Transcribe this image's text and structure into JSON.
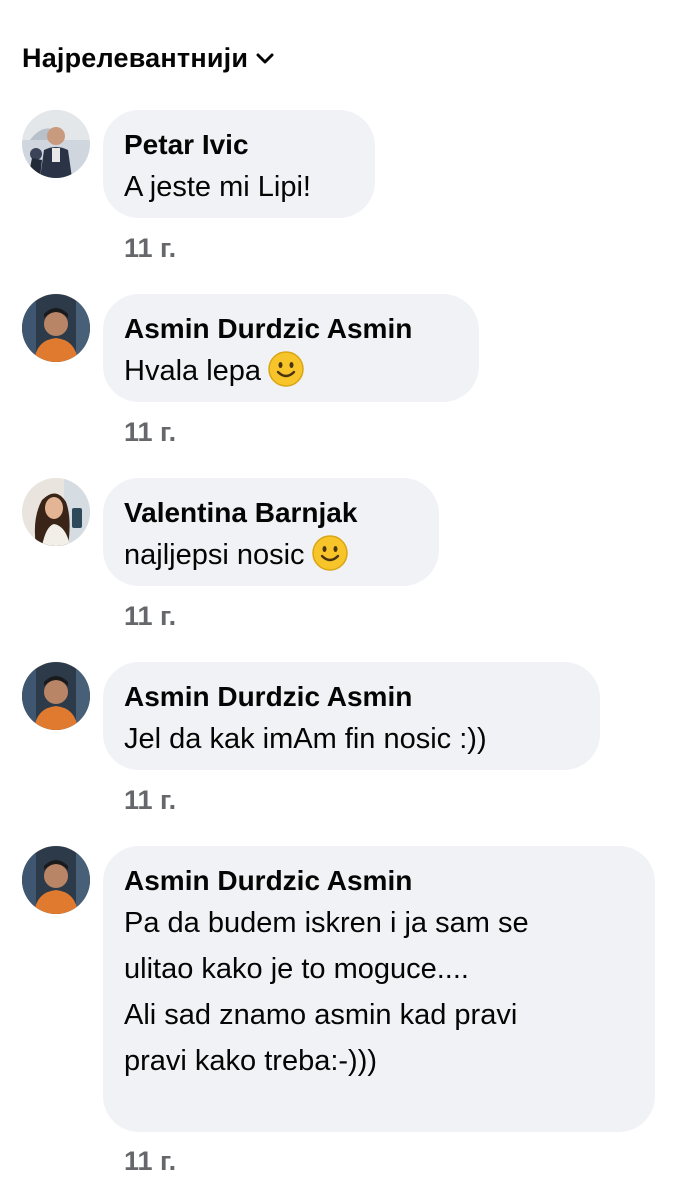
{
  "sort": {
    "label": "Најрелевантнији",
    "icon": "chevron-down-icon"
  },
  "comments": [
    {
      "author": "Petar Ivic",
      "text": "A jeste mi Lipi!",
      "emoji": null,
      "time": "11 г.",
      "avatar_icon": "avatar-petar"
    },
    {
      "author": "Asmin Durdzic Asmin",
      "text": "Hvala lepa",
      "emoji": "smiley-emoji",
      "time": "11 г.",
      "avatar_icon": "avatar-asmin"
    },
    {
      "author": "Valentina Barnjak",
      "text": "najljepsi nosic",
      "emoji": "smiley-emoji",
      "time": "11 г.",
      "avatar_icon": "avatar-valentina"
    },
    {
      "author": "Asmin Durdzic Asmin",
      "text": "Jel da kak imAm fin nosic :))",
      "emoji": null,
      "time": "11 г.",
      "avatar_icon": "avatar-asmin"
    },
    {
      "author": "Asmin Durdzic Asmin",
      "text": "Pa da budem iskren i ja sam se\nulitao kako je to moguce....\nAli sad znamo asmin kad pravi\npravi kako treba:-)))",
      "emoji": null,
      "time": "11 г.",
      "avatar_icon": "avatar-asmin"
    }
  ],
  "colors": {
    "bubble": "#f0f2f5",
    "meta": "#65676b",
    "text": "#050505"
  }
}
